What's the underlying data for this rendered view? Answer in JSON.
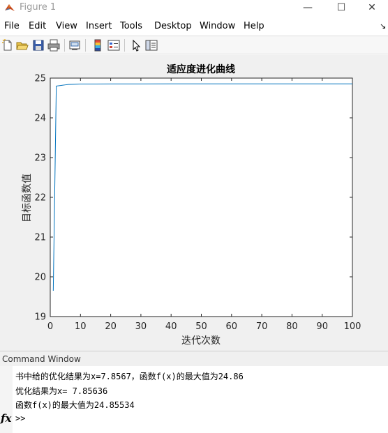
{
  "window": {
    "title": "Figure 1",
    "minimize_glyph": "—",
    "maximize_glyph": "☐",
    "close_glyph": "✕"
  },
  "menu": {
    "items": [
      "File",
      "Edit",
      "View",
      "Insert",
      "Tools",
      "Desktop",
      "Window",
      "Help"
    ],
    "dock_glyph": "↘"
  },
  "toolbar": {
    "buttons": [
      "new-figure-icon",
      "open-file-icon",
      "save-icon",
      "print-icon",
      "link-plot-icon",
      "insert-colorbar-icon",
      "insert-legend-icon",
      "edit-plot-icon",
      "property-inspector-icon"
    ]
  },
  "chart_data": {
    "type": "line",
    "title": "适应度进化曲线",
    "xlabel": "迭代次数",
    "ylabel": "目标函数值",
    "xlim": [
      0,
      100
    ],
    "ylim": [
      19,
      25
    ],
    "xticks": [
      0,
      10,
      20,
      30,
      40,
      50,
      60,
      70,
      80,
      90,
      100
    ],
    "yticks": [
      19,
      20,
      21,
      22,
      23,
      24,
      25
    ],
    "grid": false,
    "line_color": "#0072bd",
    "series": [
      {
        "x": [
          1,
          2,
          3,
          4,
          5,
          6,
          8,
          10,
          15,
          20,
          30,
          40,
          50,
          60,
          70,
          80,
          90,
          100
        ],
        "y": [
          19.65,
          24.8,
          24.81,
          24.82,
          24.83,
          24.84,
          24.845,
          24.85,
          24.852,
          24.853,
          24.854,
          24.855,
          24.855,
          24.855,
          24.855,
          24.855,
          24.855,
          24.855
        ]
      }
    ]
  },
  "command_window": {
    "header": "Command Window",
    "lines": [
      "书中给的优化结果为x=7.8567，函数f(x)的最大值为24.86",
      "优化结果为x= 7.85636",
      "函数f(x)的最大值为24.85534"
    ],
    "fx_label": "fx",
    "prompt": ">>"
  }
}
